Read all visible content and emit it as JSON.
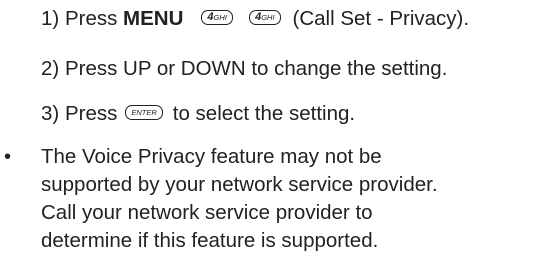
{
  "steps": [
    {
      "num": "1)",
      "pre": "Press",
      "bold": "MENU",
      "key1": {
        "big": "4",
        "small": "GHI"
      },
      "key2": {
        "big": "4",
        "small": "GHI"
      },
      "post": "(Call Set - Privacy)."
    },
    {
      "num": "2)",
      "text": "Press UP or DOWN to change the setting."
    },
    {
      "num": "3)",
      "pre": "Press",
      "key": "ENTER",
      "post": "to select the setting."
    }
  ],
  "note": {
    "bullet": "•",
    "lines": [
      "The Voice Privacy feature may not be",
      "supported by your network service provider.",
      "Call your network service provider to",
      "determine if this feature is supported."
    ]
  }
}
